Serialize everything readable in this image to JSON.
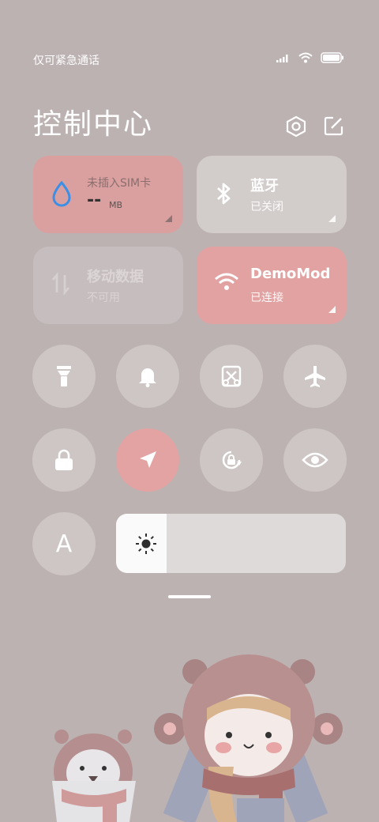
{
  "status": {
    "carrier": "仅可紧急通话",
    "icons": [
      "signal-icon",
      "wifi-icon",
      "battery-icon"
    ]
  },
  "header": {
    "title": "控制中心",
    "icons": [
      "settings-icon",
      "edit-icon"
    ]
  },
  "tiles": {
    "sim": {
      "title": "未插入SIM卡",
      "value": "--",
      "unit": "MB"
    },
    "bluetooth": {
      "title": "蓝牙",
      "status": "已关闭"
    },
    "mobile_data": {
      "title": "移动数据",
      "status": "不可用"
    },
    "wifi": {
      "title": "DemoMod",
      "status": "已连接"
    }
  },
  "toggles": [
    {
      "name": "flashlight-icon",
      "active": false
    },
    {
      "name": "bell-icon",
      "active": false
    },
    {
      "name": "screenshot-icon",
      "active": false
    },
    {
      "name": "airplane-icon",
      "active": false
    },
    {
      "name": "lock-icon",
      "active": false
    },
    {
      "name": "location-icon",
      "active": true
    },
    {
      "name": "rotation-lock-icon",
      "active": false
    },
    {
      "name": "eye-icon",
      "active": false
    }
  ],
  "font_toggle": {
    "label": "A"
  },
  "brightness": {
    "level": 0.22
  },
  "colors": {
    "background": "#bcb2b2",
    "active_tile": "#e2a2a2",
    "inactive_tile": "#d2cccb"
  }
}
